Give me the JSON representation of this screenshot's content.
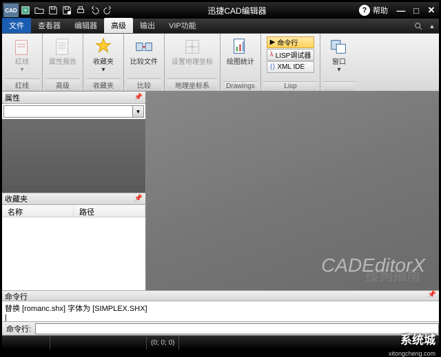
{
  "app": {
    "title": "迅捷CAD编辑器",
    "logo": "CAD",
    "help": "帮助"
  },
  "quick": [
    "new",
    "open",
    "save",
    "saveas",
    "print",
    "undo",
    "redo"
  ],
  "tabs": {
    "file": "文件",
    "items": [
      "查看器",
      "编辑器",
      "高级",
      "输出",
      "VIP功能"
    ],
    "active": "高级"
  },
  "ribbon": {
    "groups": [
      {
        "title": "红线",
        "btns": [
          {
            "label": "红线",
            "icon": "redline",
            "dis": true,
            "dd": true
          }
        ]
      },
      {
        "title": "高级",
        "btns": [
          {
            "label": "属性报告",
            "icon": "report",
            "dis": true
          }
        ]
      },
      {
        "title": "收藏夹",
        "btns": [
          {
            "label": "收藏夹",
            "icon": "fav",
            "dd": true
          }
        ]
      },
      {
        "title": "比较",
        "btns": [
          {
            "label": "比较文件",
            "icon": "compare"
          }
        ]
      },
      {
        "title": "地理坐标系",
        "btns": [
          {
            "label": "设置地理坐标",
            "icon": "geo",
            "dis": true
          }
        ]
      },
      {
        "title": "Drawings",
        "btns": [
          {
            "label": "绘图统计",
            "icon": "stats"
          }
        ]
      },
      {
        "title": "Lisp",
        "lisp": [
          {
            "label": "命令行",
            "hl": true,
            "icon": "cmd"
          },
          {
            "label": "LISP调试器",
            "icon": "lisp"
          },
          {
            "label": "XML IDE",
            "icon": "xml"
          }
        ]
      },
      {
        "title": "",
        "btns": [
          {
            "label": "窗口",
            "icon": "window",
            "dd": true
          }
        ]
      }
    ]
  },
  "panels": {
    "prop_title": "属性",
    "fav_title": "收藏夹",
    "fav_cols": [
      "名称",
      "路径"
    ]
  },
  "canvas": {
    "brand": "CADEditorX"
  },
  "cmd": {
    "title": "命令行",
    "log": "替换 [romanc.shx] 字体为 [SIMPLEX.SHX]\n|",
    "label": "命令行:"
  },
  "status": {
    "coords": "(0; 0; 0)"
  },
  "watermark": {
    "brand": "搜狗指南",
    "site": "系统城",
    "url": "xitongcheng.com"
  }
}
